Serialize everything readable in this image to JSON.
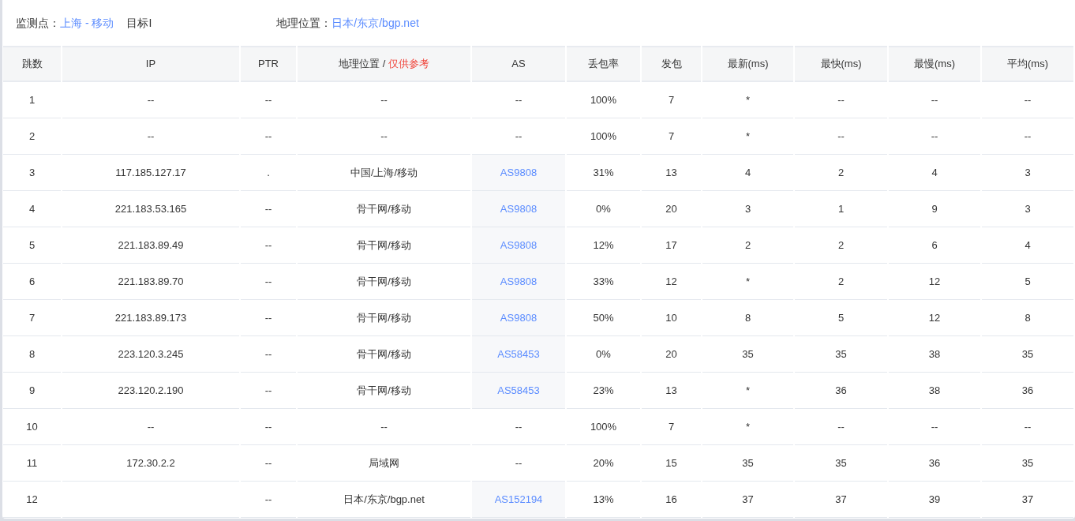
{
  "header": {
    "monitor_label": "监测点：",
    "monitor_value": "上海 - 移动",
    "target_label": "目标I",
    "geo_label": "地理位置：",
    "geo_value": "日本/东京/bgp.net"
  },
  "columns": [
    {
      "label": "跳数"
    },
    {
      "label": "IP"
    },
    {
      "label": "PTR"
    },
    {
      "label": "地理位置 /",
      "note": "仅供参考"
    },
    {
      "label": "AS"
    },
    {
      "label": "丢包率"
    },
    {
      "label": "发包"
    },
    {
      "label": "最新(ms)"
    },
    {
      "label": "最快(ms)"
    },
    {
      "label": "最慢(ms)"
    },
    {
      "label": "平均(ms)"
    }
  ],
  "rows": [
    {
      "hop": "1",
      "ip": "--",
      "ptr": "--",
      "geo": "--",
      "as": {
        "text": "--",
        "link": false
      },
      "loss": "100%",
      "sent": "7",
      "last": "*",
      "best": "--",
      "worst": "--",
      "avg": "--"
    },
    {
      "hop": "2",
      "ip": "--",
      "ptr": "--",
      "geo": "--",
      "as": {
        "text": "--",
        "link": false
      },
      "loss": "100%",
      "sent": "7",
      "last": "*",
      "best": "--",
      "worst": "--",
      "avg": "--"
    },
    {
      "hop": "3",
      "ip": "117.185.127.17",
      "ptr": ".",
      "geo": "中国/上海/移动",
      "as": {
        "text": "AS9808",
        "link": true
      },
      "loss": "31%",
      "sent": "13",
      "last": "4",
      "best": "2",
      "worst": "4",
      "avg": "3"
    },
    {
      "hop": "4",
      "ip": "221.183.53.165",
      "ptr": "--",
      "geo": "骨干网/移动",
      "as": {
        "text": "AS9808",
        "link": true
      },
      "loss": "0%",
      "sent": "20",
      "last": "3",
      "best": "1",
      "worst": "9",
      "avg": "3"
    },
    {
      "hop": "5",
      "ip": "221.183.89.49",
      "ptr": "--",
      "geo": "骨干网/移动",
      "as": {
        "text": "AS9808",
        "link": true
      },
      "loss": "12%",
      "sent": "17",
      "last": "2",
      "best": "2",
      "worst": "6",
      "avg": "4"
    },
    {
      "hop": "6",
      "ip": "221.183.89.70",
      "ptr": "--",
      "geo": "骨干网/移动",
      "as": {
        "text": "AS9808",
        "link": true
      },
      "loss": "33%",
      "sent": "12",
      "last": "*",
      "best": "2",
      "worst": "12",
      "avg": "5"
    },
    {
      "hop": "7",
      "ip": "221.183.89.173",
      "ptr": "--",
      "geo": "骨干网/移动",
      "as": {
        "text": "AS9808",
        "link": true
      },
      "loss": "50%",
      "sent": "10",
      "last": "8",
      "best": "5",
      "worst": "12",
      "avg": "8"
    },
    {
      "hop": "8",
      "ip": "223.120.3.245",
      "ptr": "--",
      "geo": "骨干网/移动",
      "as": {
        "text": "AS58453",
        "link": true
      },
      "loss": "0%",
      "sent": "20",
      "last": "35",
      "best": "35",
      "worst": "38",
      "avg": "35"
    },
    {
      "hop": "9",
      "ip": "223.120.2.190",
      "ptr": "--",
      "geo": "骨干网/移动",
      "as": {
        "text": "AS58453",
        "link": true
      },
      "loss": "23%",
      "sent": "13",
      "last": "*",
      "best": "36",
      "worst": "38",
      "avg": "36"
    },
    {
      "hop": "10",
      "ip": "--",
      "ptr": "--",
      "geo": "--",
      "as": {
        "text": "--",
        "link": false
      },
      "loss": "100%",
      "sent": "7",
      "last": "*",
      "best": "--",
      "worst": "--",
      "avg": "--"
    },
    {
      "hop": "11",
      "ip": "172.30.2.2",
      "ptr": "--",
      "geo": "局域网",
      "as": {
        "text": "--",
        "link": false
      },
      "loss": "20%",
      "sent": "15",
      "last": "35",
      "best": "35",
      "worst": "36",
      "avg": "35"
    },
    {
      "hop": "12",
      "ptr": "--",
      "geo": "日本/东京/bgp.net",
      "as": {
        "text": "AS152194",
        "link": true
      },
      "loss": "13%",
      "sent": "16",
      "last": "37",
      "best": "37",
      "worst": "39",
      "avg": "37"
    }
  ]
}
